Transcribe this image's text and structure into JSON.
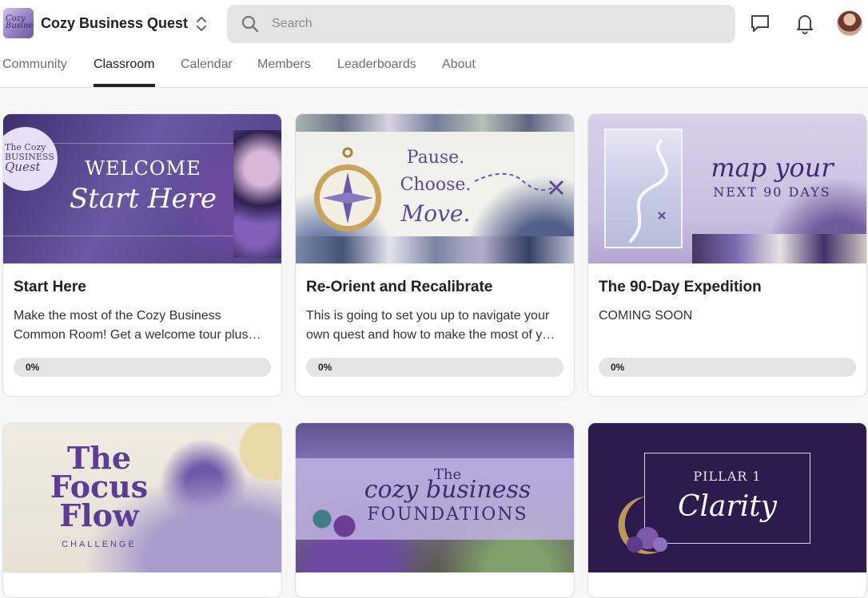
{
  "header": {
    "brand": "Cozy Business Quest",
    "logo_text": "Cozy Business",
    "search_placeholder": "Search",
    "icons": [
      "chat-icon",
      "bell-icon",
      "avatar"
    ]
  },
  "tabs": [
    {
      "label": "Community",
      "active": false
    },
    {
      "label": "Classroom",
      "active": true
    },
    {
      "label": "Calendar",
      "active": false
    },
    {
      "label": "Members",
      "active": false
    },
    {
      "label": "Leaderboards",
      "active": false
    },
    {
      "label": "About",
      "active": false
    }
  ],
  "colors": {
    "accent": "#5b4a9a",
    "banner_dark": "#2d1b4e",
    "progress_track": "#e4e4e4"
  },
  "courses": [
    {
      "title": "Start Here",
      "description": "Make the most of the Cozy Business Common Room! Get a welcome tour plus tips and tricks.",
      "progress_label": "0%",
      "progress": 0,
      "banner": {
        "badge_lines": [
          "The Cozy",
          "BUSINESS",
          "Quest"
        ],
        "line1": "WELCOME",
        "line2": "Start Here"
      }
    },
    {
      "title": "Re-Orient and Recalibrate",
      "description": "This is going to set you up to navigate your own quest and how to make the most of your time here.",
      "progress_label": "0%",
      "progress": 0,
      "banner": {
        "line1": "Pause.",
        "line2": "Choose.",
        "line3": "Move."
      }
    },
    {
      "title": "The 90-Day Expedition",
      "description": "COMING SOON",
      "progress_label": "0%",
      "progress": 0,
      "banner": {
        "line1": "map your",
        "line2": "NEXT 90 DAYS"
      }
    },
    {
      "title": "",
      "description": "",
      "progress_label": "",
      "progress": 0,
      "banner": {
        "line1": "The",
        "line2": "Focus",
        "line3": "Flow",
        "line4": "CHALLENGE"
      }
    },
    {
      "title": "",
      "description": "",
      "progress_label": "",
      "progress": 0,
      "banner": {
        "line1": "The",
        "line2": "cozy business",
        "line3": "FOUNDATIONS"
      }
    },
    {
      "title": "",
      "description": "",
      "progress_label": "",
      "progress": 0,
      "banner": {
        "line1": "PILLAR 1",
        "line2": "Clarity"
      }
    }
  ]
}
